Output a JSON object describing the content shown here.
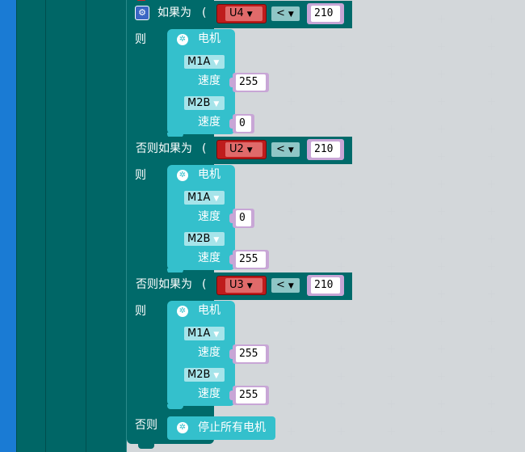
{
  "colors": {
    "nest": "#006666",
    "control_block": "#006a6a",
    "motor_block": "#34c0cc",
    "sensor_block": "#bf1c1c",
    "number_block": "#c8a6d6",
    "side_bar": "#1a7bd4"
  },
  "icons": {
    "gear": "gear-icon",
    "motor": "motor-icon",
    "dropdown": "triangle-down-icon"
  },
  "if_block": {
    "branches": [
      {
        "keyword": "如果为",
        "paren": "(",
        "sensor": "U4",
        "operator": "<",
        "value": "210",
        "then_label": "则",
        "motor": {
          "title": "电机",
          "rows": [
            {
              "pin": "M1A",
              "speed_label": "速度",
              "speed": "255"
            },
            {
              "pin": "M2B",
              "speed_label": "速度",
              "speed": "0"
            }
          ]
        }
      },
      {
        "keyword": "否则如果为",
        "paren": "(",
        "sensor": "U2",
        "operator": "<",
        "value": "210",
        "then_label": "则",
        "motor": {
          "title": "电机",
          "rows": [
            {
              "pin": "M1A",
              "speed_label": "速度",
              "speed": "0"
            },
            {
              "pin": "M2B",
              "speed_label": "速度",
              "speed": "255"
            }
          ]
        }
      },
      {
        "keyword": "否则如果为",
        "paren": "(",
        "sensor": "U3",
        "operator": "<",
        "value": "210",
        "then_label": "则",
        "motor": {
          "title": "电机",
          "rows": [
            {
              "pin": "M1A",
              "speed_label": "速度",
              "speed": "255"
            },
            {
              "pin": "M2B",
              "speed_label": "速度",
              "speed": "255"
            }
          ]
        }
      }
    ],
    "else_label": "否则",
    "else_action": "停止所有电机"
  }
}
